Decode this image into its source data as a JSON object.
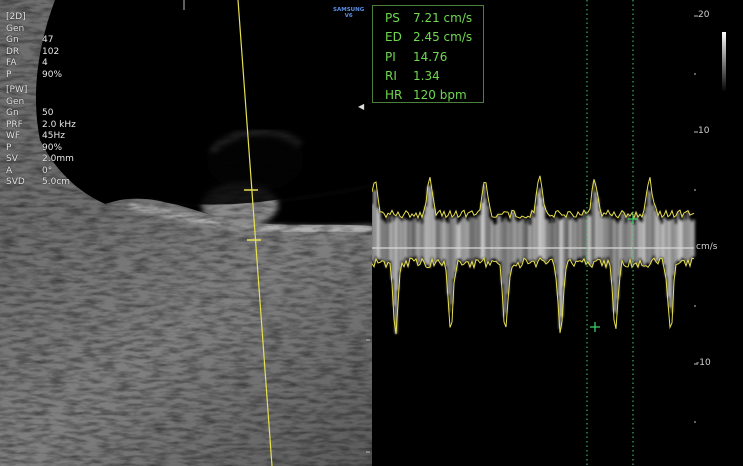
{
  "manufacturer": {
    "brand": "SAMSUNG",
    "model": "V6"
  },
  "bmode_params": [
    {
      "key": "[2D]",
      "value": ""
    },
    {
      "key": "Gen",
      "value": ""
    },
    {
      "key": "Gn",
      "value": "47"
    },
    {
      "key": "DR",
      "value": "102"
    },
    {
      "key": "FA",
      "value": "4"
    },
    {
      "key": "P",
      "value": "90%"
    }
  ],
  "pw_params": [
    {
      "key": "[PW]",
      "value": ""
    },
    {
      "key": "Gen",
      "value": ""
    },
    {
      "key": "Gn",
      "value": "50"
    },
    {
      "key": "PRF",
      "value": "2.0 kHz"
    },
    {
      "key": "WF",
      "value": "45Hz"
    },
    {
      "key": "P",
      "value": "90%"
    },
    {
      "key": "SV",
      "value": "2.0mm"
    },
    {
      "key": "A",
      "value": "0°"
    },
    {
      "key": "SVD",
      "value": "5.0cm"
    }
  ],
  "measurements": [
    {
      "label": "PS",
      "value": "7.21 cm/s"
    },
    {
      "label": "ED",
      "value": "2.45 cm/s"
    },
    {
      "label": "PI",
      "value": "14.76"
    },
    {
      "label": "RI",
      "value": "1.34"
    },
    {
      "label": "HR",
      "value": "120 bpm"
    }
  ],
  "velocity_scale": {
    "unit": "cm/s",
    "ticks": [
      "20",
      "10",
      "-10"
    ]
  },
  "colors": {
    "measure_text": "#6fd84f",
    "measure_border": "#4d7f3c",
    "trace": "#e8e050",
    "caliper": "#3fd86a",
    "brand": "#5b8fe6"
  }
}
